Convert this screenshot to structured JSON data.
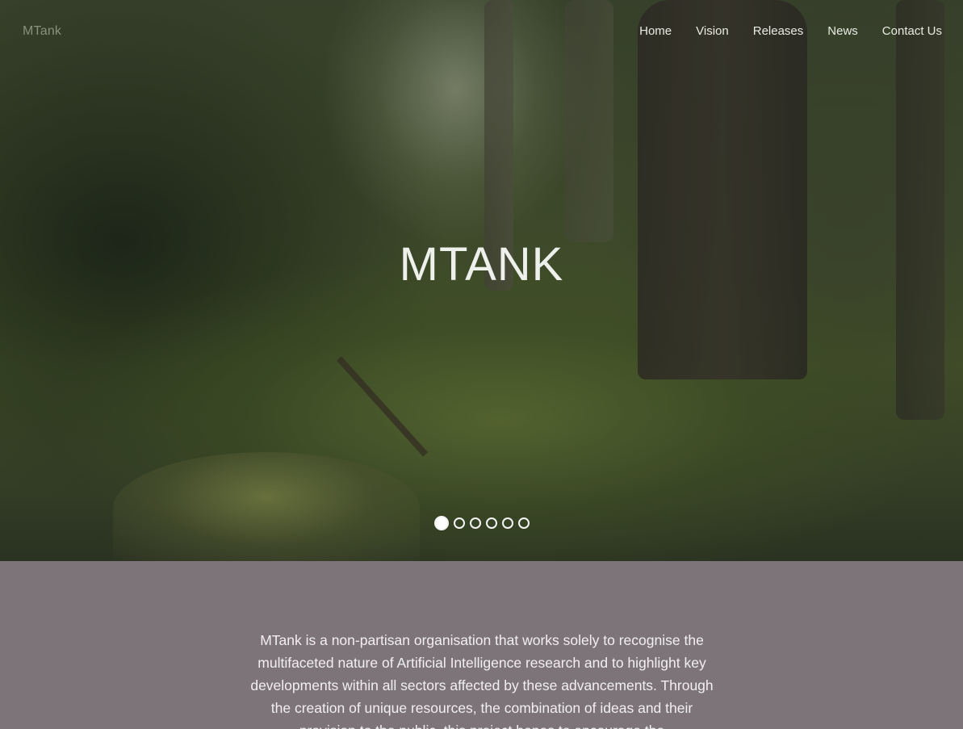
{
  "header": {
    "brand": "MTank",
    "nav": [
      "Home",
      "Vision",
      "Releases",
      "News",
      "Contact Us"
    ]
  },
  "hero": {
    "title": "MTANK",
    "carousel": {
      "slide_count": 6,
      "active_slide": 1
    }
  },
  "intro": {
    "text": "MTank is a non-partisan organisation that works solely to recognise the multifaceted nature of Artificial Intelligence research and to highlight key developments within all sectors affected by these advancements. Through the creation of unique resources, the combination of ideas and their provision to the public, this project hopes to encourage the"
  },
  "colors": {
    "intro_background": "#7c7479",
    "nav_text": "#e9ebe2",
    "hero_title": "#eef0ec"
  }
}
